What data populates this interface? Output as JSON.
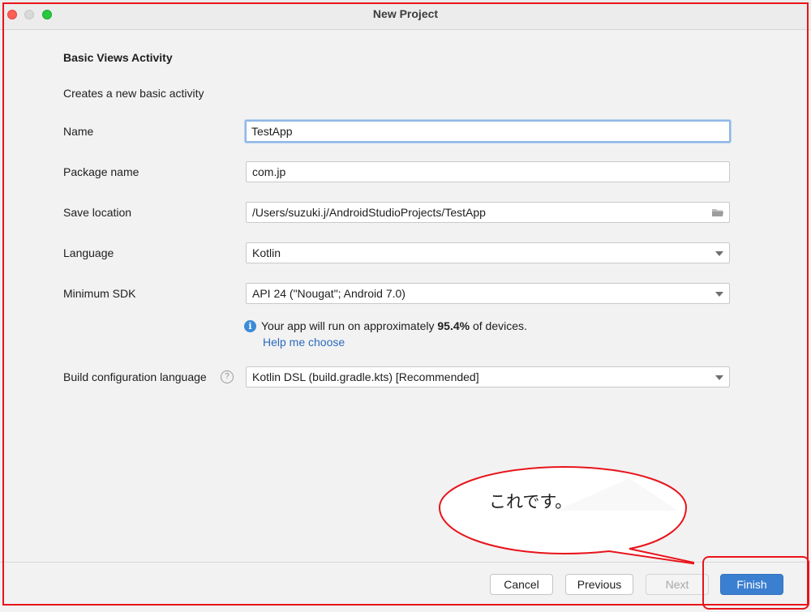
{
  "window": {
    "title": "New Project"
  },
  "form": {
    "heading": "Basic Views Activity",
    "description": "Creates a new basic activity",
    "name": {
      "label": "Name",
      "value": "TestApp"
    },
    "package_name": {
      "label": "Package name",
      "value": "com.jp"
    },
    "save_location": {
      "label": "Save location",
      "value": "/Users/suzuki.j/AndroidStudioProjects/TestApp"
    },
    "language": {
      "label": "Language",
      "value": "Kotlin"
    },
    "minimum_sdk": {
      "label": "Minimum SDK",
      "value": "API 24 (\"Nougat\"; Android 7.0)"
    },
    "info": {
      "prefix": "Your app will run on approximately ",
      "percent": "95.4%",
      "suffix": " of devices.",
      "link": "Help me choose"
    },
    "build_config": {
      "label": "Build configuration language",
      "value": "Kotlin DSL (build.gradle.kts) [Recommended]"
    }
  },
  "buttons": {
    "cancel": "Cancel",
    "previous": "Previous",
    "next": "Next",
    "finish": "Finish"
  },
  "annotation": {
    "callout_text": "これです。",
    "highlight_color": "#e8141b"
  },
  "colors": {
    "accent": "#3a7fd0",
    "link": "#2c6bbd",
    "info": "#3b8bd8"
  }
}
